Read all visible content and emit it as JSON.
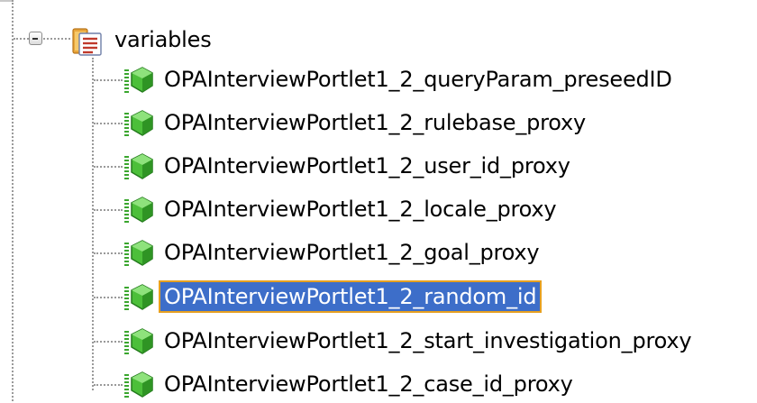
{
  "tree": {
    "root": {
      "label": "variables",
      "icon": "folder-list-icon",
      "expanded": true
    },
    "items": [
      {
        "label": "OPAInterviewPortlet1_2_queryParam_preseedID",
        "icon": "variable-cube-icon",
        "selected": false
      },
      {
        "label": "OPAInterviewPortlet1_2_rulebase_proxy",
        "icon": "variable-cube-icon",
        "selected": false
      },
      {
        "label": "OPAInterviewPortlet1_2_user_id_proxy",
        "icon": "variable-cube-icon",
        "selected": false
      },
      {
        "label": "OPAInterviewPortlet1_2_locale_proxy",
        "icon": "variable-cube-icon",
        "selected": false
      },
      {
        "label": "OPAInterviewPortlet1_2_goal_proxy",
        "icon": "variable-cube-icon",
        "selected": false
      },
      {
        "label": "OPAInterviewPortlet1_2_random_id",
        "icon": "variable-cube-icon",
        "selected": true
      },
      {
        "label": "OPAInterviewPortlet1_2_start_investigation_proxy",
        "icon": "variable-cube-icon",
        "selected": false
      },
      {
        "label": "OPAInterviewPortlet1_2_case_id_proxy",
        "icon": "variable-cube-icon",
        "selected": false
      }
    ]
  },
  "colors": {
    "selection_bg": "#3d6ec9",
    "selection_border": "#e6a020",
    "cube_green": "#3aa62e"
  }
}
